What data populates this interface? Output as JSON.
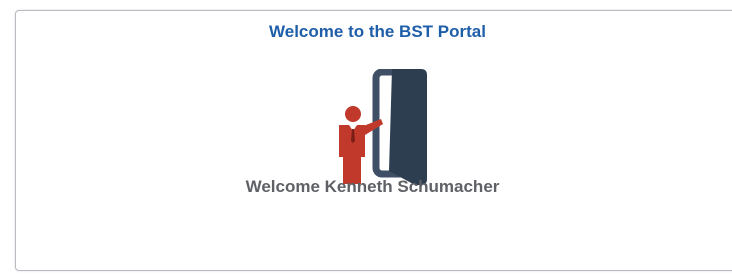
{
  "tile": {
    "title": "Welcome to the BST Portal",
    "illustration_icon": "person-at-open-door-icon",
    "greeting": "Welcome Kenneth Schumacher"
  },
  "colors": {
    "title": "#1f5ea8",
    "greeting": "#5f6166",
    "person": "#c0392b",
    "door": "#2c3e50",
    "door_frame": "#3f5066"
  }
}
